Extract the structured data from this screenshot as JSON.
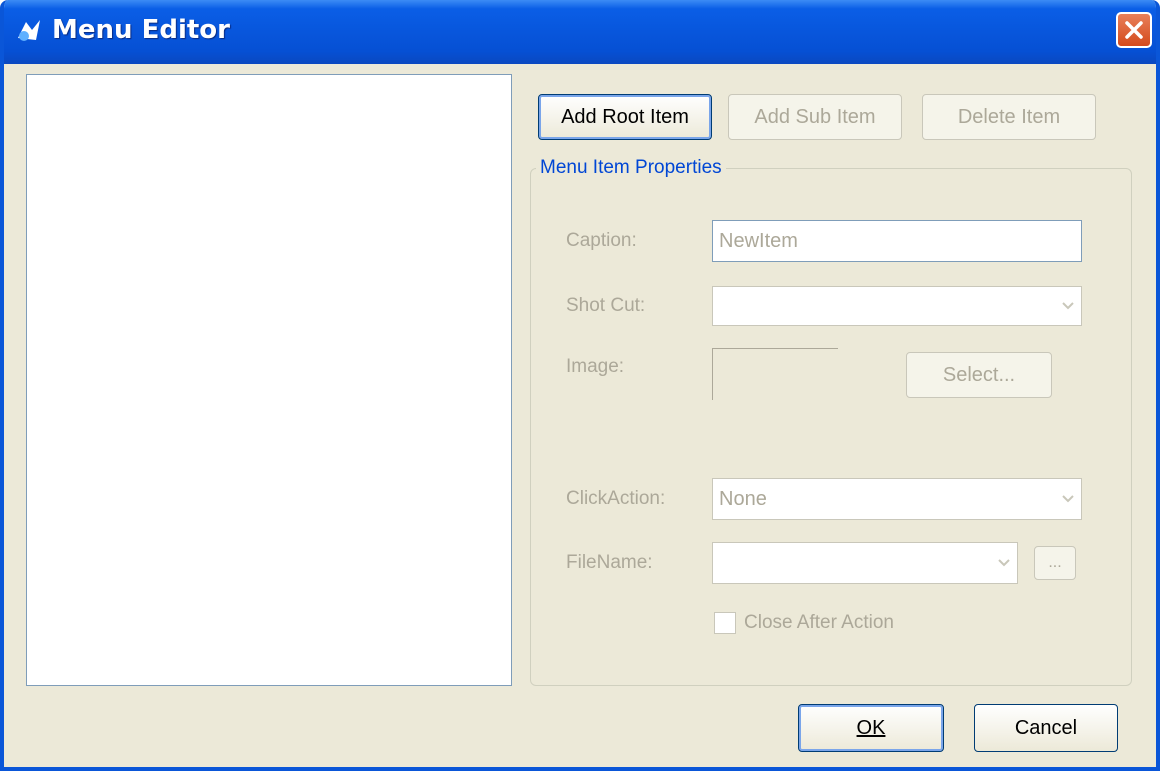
{
  "window": {
    "title": "Menu Editor",
    "close_icon": "close-icon"
  },
  "toolbar": {
    "add_root": "Add Root Item",
    "add_sub": "Add Sub Item",
    "delete": "Delete Item"
  },
  "properties": {
    "group_title": "Menu Item Properties",
    "caption_label": "Caption:",
    "caption_value": "NewItem",
    "shortcut_label": "Shot Cut:",
    "shortcut_value": "",
    "image_label": "Image:",
    "select_button": "Select...",
    "click_action_label": "ClickAction:",
    "click_action_value": "None",
    "filename_label": "FileName:",
    "filename_value": "",
    "browse_button": "...",
    "close_after_label": "Close After Action",
    "close_after_checked": false
  },
  "footer": {
    "ok": "OK",
    "cancel": "Cancel"
  },
  "colors": {
    "titlebar": "#0856dc",
    "background": "#ece9d8",
    "group_title": "#0046d5",
    "disabled_text": "#aca899"
  }
}
